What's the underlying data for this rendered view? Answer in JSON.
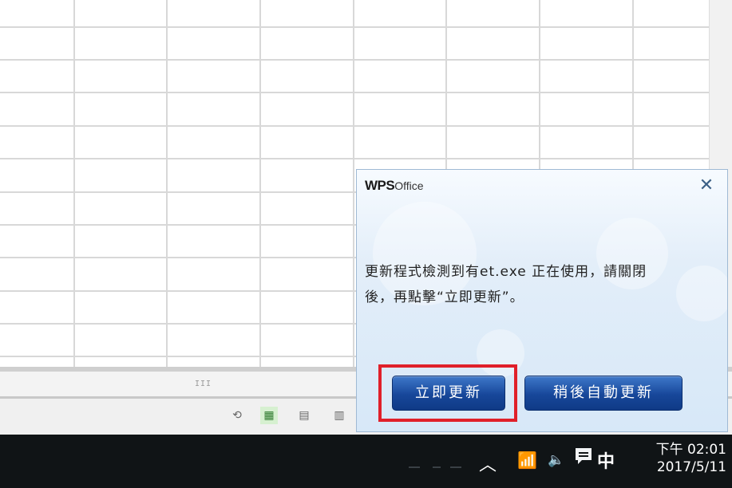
{
  "statusbar": {
    "icons": [
      "history-icon",
      "normal-view-icon",
      "page-layout-icon",
      "page-break-view-icon"
    ],
    "active_icon": "normal-view-icon"
  },
  "scrollbar": {
    "grip": "III"
  },
  "dialog": {
    "logo_brand": "WPS",
    "logo_product": "Office",
    "close_symbol": "✕",
    "message_line1": "更新程式檢測到有et.exe 正在使用，請關閉",
    "message_line2": "後，再點擊“立即更新”。",
    "button_update_now": "立即更新",
    "button_later": "稍後自動更新",
    "highlight_color": "#e0202a",
    "button_color": "#17479a"
  },
  "taskbar": {
    "ime_label": "中",
    "clock_time": "下午 02:01",
    "clock_date": "2017/5/11",
    "tray_icons": [
      "show-hidden-icons-icon",
      "wifi-icon",
      "volume-icon",
      "notification-icon"
    ]
  }
}
